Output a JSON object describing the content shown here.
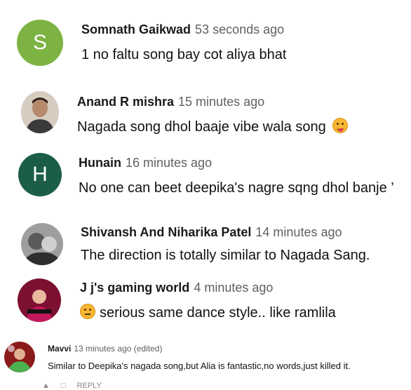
{
  "comments": [
    {
      "author": "Somnath Gaikwad",
      "time": "53 seconds ago",
      "text": "1 no faltu song bay cot aliya bhat",
      "avatar_letter": "S",
      "avatar_color": "#7cb342"
    },
    {
      "author": "Anand R mishra",
      "time": "15 minutes ago",
      "text": "Nagada song dhol baaje vibe wala song",
      "emoji": "tongue-face-icon"
    },
    {
      "author": "Hunain",
      "time": "16 minutes ago",
      "text": "No one can beet deepika's nagre sqng dhol banje ’",
      "avatar_letter": "H",
      "avatar_color": "#1b5e45"
    },
    {
      "author": "Shivansh And Niharika Patel",
      "time": "14 minutes ago",
      "text": "The direction is totally similar to Nagada Sang."
    },
    {
      "author": "J j's gaming world",
      "time": "4 minutes ago",
      "text": "serious same dance style.. like ramlila",
      "emoji": "neutral-face-icon"
    },
    {
      "author": "Mavvi",
      "time": "13 minutes ago (edited)",
      "text": "Similar to Deepika's nagada song,but Alia is fantastic,no words,just killed it."
    }
  ],
  "footer": {
    "reply_label": "REPLY"
  }
}
